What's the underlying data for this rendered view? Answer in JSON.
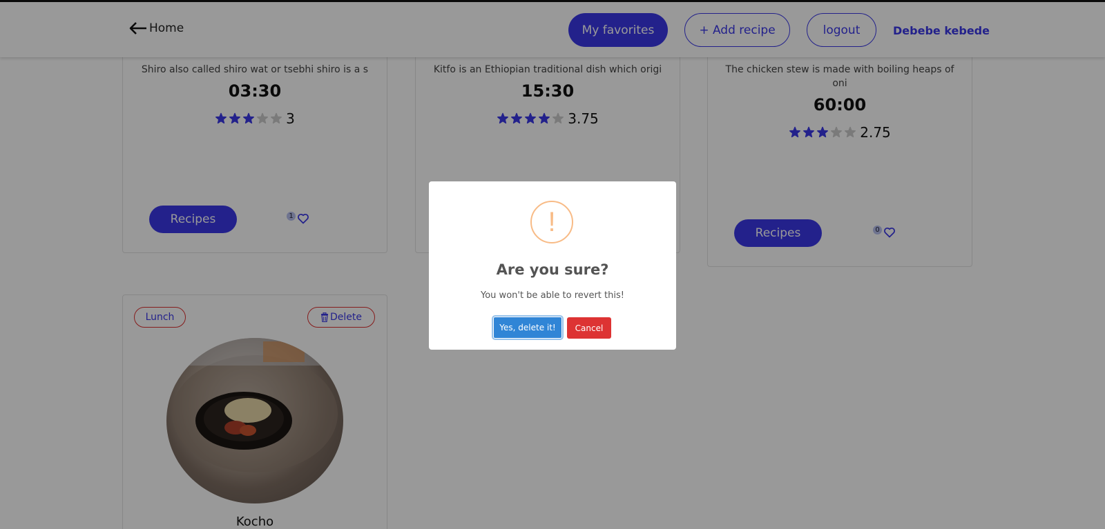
{
  "navbar": {
    "home_label": "Home",
    "favorites_label": "My favorites",
    "add_recipe_label": "+ Add recipe",
    "logout_label": "logout",
    "user_name": "Debebe kebede"
  },
  "cards": [
    {
      "description": "Shiro also called shiro wat or tsebhi shiro is a s",
      "time": "03:30",
      "rating": 3,
      "rating_text": "3",
      "button_label": "Recipes",
      "favorites_count": "1"
    },
    {
      "description": "Kitfo is an Ethiopian traditional dish which origi",
      "time": "15:30",
      "rating": 3.75,
      "rating_text": "3.75"
    },
    {
      "description": "The chicken stew is made with boiling heaps of oni",
      "time": "60:00",
      "rating": 2.75,
      "rating_text": "2.75",
      "button_label": "Recipes",
      "favorites_count": "0"
    },
    {
      "tag_label": "Lunch",
      "delete_label": "Delete",
      "title": "Kocho"
    }
  ],
  "modal": {
    "title": "Are you sure?",
    "text": "You won't be able to revert this!",
    "confirm_label": "Yes, delete it!",
    "cancel_label": "Cancel",
    "icon_symbol": "!"
  },
  "colors": {
    "accent": "#3b38e8",
    "star_empty": "#cccccc",
    "warning": "#f8bb86",
    "confirm": "#3085d6",
    "cancel": "#dd3333"
  }
}
